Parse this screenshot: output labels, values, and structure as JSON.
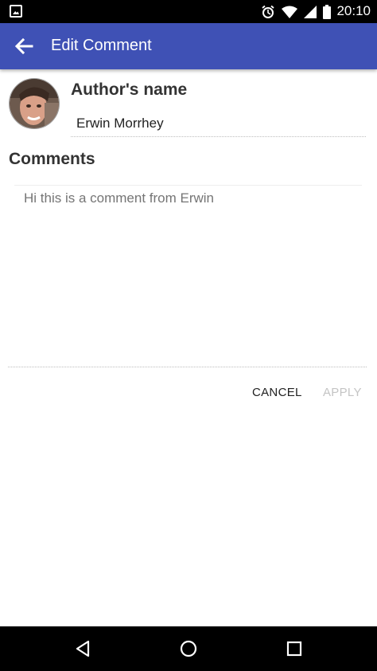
{
  "status_bar": {
    "time": "20:10",
    "icons": [
      "image-icon",
      "alarm-icon",
      "wifi-icon",
      "signal-icon",
      "battery-icon"
    ]
  },
  "app_bar": {
    "title": "Edit Comment",
    "background": "#3f51b5"
  },
  "form": {
    "author_label": "Author's name",
    "author_value": "Erwin Morrhey",
    "comments_label": "Comments",
    "comments_placeholder": "Hi this is a comment from Erwin",
    "cancel_label": "CANCEL",
    "apply_label": "APPLY"
  },
  "nav_bar": {
    "icons": [
      "back-nav-icon",
      "home-nav-icon",
      "recents-nav-icon"
    ]
  }
}
